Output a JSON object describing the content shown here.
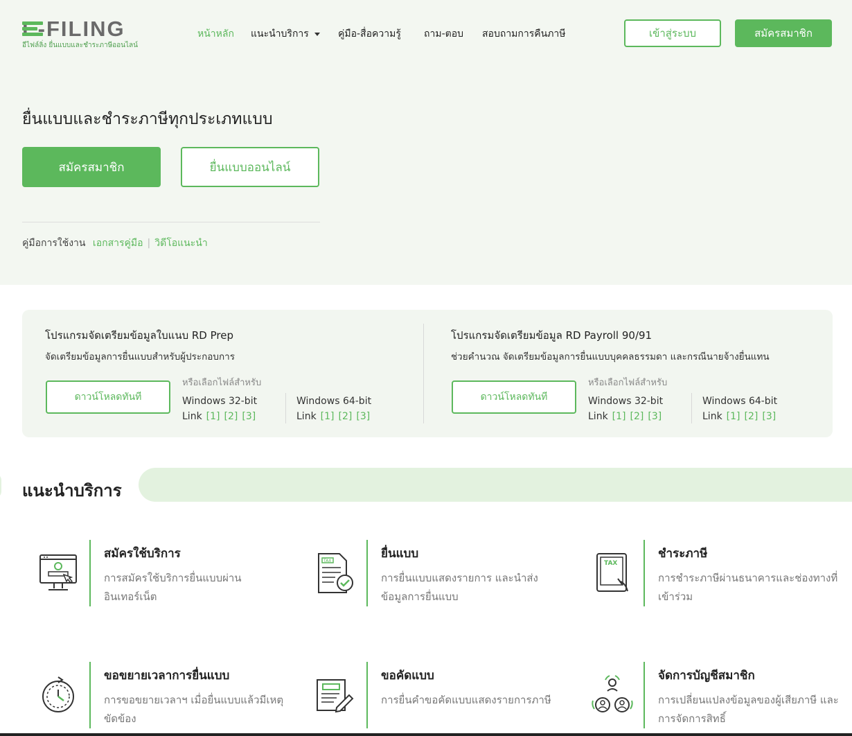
{
  "header": {
    "logo_text": "E-FILING",
    "logo_sub": "อีไฟล์ลิ่ง ยื่นแบบและชำระภาษีออนไลน์",
    "nav": [
      {
        "label": "หน้าหลัก"
      },
      {
        "label": "แนะนำบริการ"
      },
      {
        "label": "คู่มือ-สื่อความรู้"
      },
      {
        "label": "ถาม-ตอบ"
      },
      {
        "label": "สอบถามการคืนภาษี"
      }
    ],
    "login_label": "เข้าสู่ระบบ",
    "register_label": "สมัครสมาชิก"
  },
  "hero": {
    "title": "ยื่นแบบและชำระภาษีทุกประเภทแบบ",
    "register_label": "สมัครสมาชิก",
    "file_online_label": "ยื่นแบบออนไลน์",
    "guide_label": "คู่มือการใช้งาน",
    "guide_doc_link": "เอกสารคู่มือ",
    "guide_video_link": "วิดีโอแนะนำ"
  },
  "downloads": [
    {
      "title": "โปรแกรมจัดเตรียมข้อมูลใบแนบ RD Prep",
      "desc": "จัดเตรียมข้อมูลการยื่นแบบสำหรับผู้ประกอบการ",
      "button": "ดาวน์โหลดทันที",
      "or_label": "หรือเลือกไฟล์สำหรับ",
      "os": [
        {
          "name": "Windows 32-bit",
          "link_label": "Link",
          "links": [
            "[1]",
            "[2]",
            "[3]"
          ]
        },
        {
          "name": "Windows 64-bit",
          "link_label": "Link",
          "links": [
            "[1]",
            "[2]",
            "[3]"
          ]
        }
      ]
    },
    {
      "title": "โปรแกรมจัดเตรียมข้อมูล RD Payroll 90/91",
      "desc": "ช่วยคำนวณ จัดเตรียมข้อมูลการยื่นแบบบุคคลธรรมดา และกรณีนายจ้างยื่นแทน",
      "button": "ดาวน์โหลดทันที",
      "or_label": "หรือเลือกไฟล์สำหรับ",
      "os": [
        {
          "name": "Windows 32-bit",
          "link_label": "Link",
          "links": [
            "[1]",
            "[2]",
            "[3]"
          ]
        },
        {
          "name": "Windows 64-bit",
          "link_label": "Link",
          "links": [
            "[1]",
            "[2]",
            "[3]"
          ]
        }
      ]
    }
  ],
  "services": {
    "heading": "แนะนำบริการ",
    "items": [
      {
        "title": "สมัครใช้บริการ",
        "desc": "การสมัครใช้บริการยื่นแบบผ่านอินเทอร์เน็ต",
        "icon": "computer-register-icon"
      },
      {
        "title": "ยื่นแบบ",
        "desc": "การยื่นแบบแสดงรายการ และนำส่งข้อมูลการยื่นแบบ",
        "icon": "tax-form-check-icon"
      },
      {
        "title": "ชำระภาษี",
        "desc": "การชำระภาษีผ่านธนาคารและช่องทางที่เข้าร่วม",
        "icon": "tax-tablet-icon"
      },
      {
        "title": "ขอขยายเวลาการยื่นแบบ",
        "desc": "การขอขยายเวลาฯ เมื่อยื่นแบบแล้วมีเหตุขัดข้อง",
        "icon": "clock-extend-icon"
      },
      {
        "title": "ขอคัดแบบ",
        "desc": "การยื่นคำขอคัดแบบแสดงรายการภาษี",
        "icon": "document-edit-icon"
      },
      {
        "title": "จัดการบัญชีสมาชิก",
        "desc": "การเปลี่ยนแปลงข้อมูลของผู้เสียภาษี และการจัดการสิทธิ์",
        "icon": "user-group-icon"
      }
    ]
  },
  "colors": {
    "accent": "#5cb85c",
    "hero_bg": "#f3f7f1",
    "panel_bg": "#f2f6f0"
  }
}
